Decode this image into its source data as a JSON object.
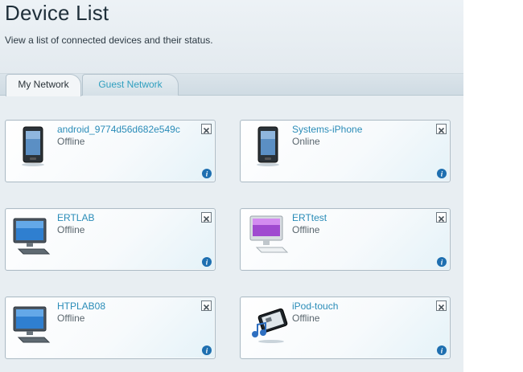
{
  "page": {
    "title": "Device List",
    "subtitle": "View a list of connected devices and their status."
  },
  "tabs": [
    {
      "label": "My Network",
      "active": true
    },
    {
      "label": "Guest Network",
      "active": false
    }
  ],
  "devices": [
    {
      "name": "android_9774d56d682e549c",
      "status": "Offline",
      "icon": "smartphone-icon"
    },
    {
      "name": "Systems-iPhone",
      "status": "Online",
      "icon": "smartphone-icon"
    },
    {
      "name": "ERTLAB",
      "status": "Offline",
      "icon": "desktop-computer-icon"
    },
    {
      "name": "ERTtest",
      "status": "Offline",
      "icon": "imac-computer-icon"
    },
    {
      "name": "HTPLAB08",
      "status": "Offline",
      "icon": "desktop-computer-icon"
    },
    {
      "name": "iPod-touch",
      "status": "Offline",
      "icon": "media-player-icon"
    }
  ],
  "colors": {
    "link": "#2a8cb8",
    "inactive_tab_text": "#2f9fbf",
    "info_badge": "#1e6fb0"
  }
}
